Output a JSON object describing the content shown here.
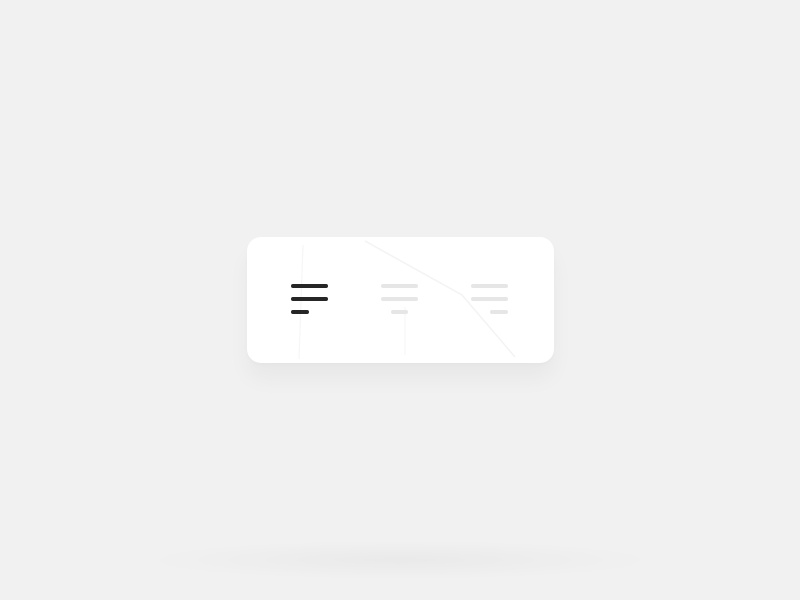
{
  "alignment_toolbar": {
    "options": [
      {
        "id": "left",
        "icon": "align-left-icon",
        "selected": true
      },
      {
        "id": "center",
        "icon": "align-center-icon",
        "selected": false
      },
      {
        "id": "right",
        "icon": "align-right-icon",
        "selected": false
      }
    ],
    "selected": "left"
  },
  "colors": {
    "background": "#f1f1f1",
    "card": "#ffffff",
    "active_icon": "#262626",
    "inactive_icon": "#e6e6e6"
  }
}
